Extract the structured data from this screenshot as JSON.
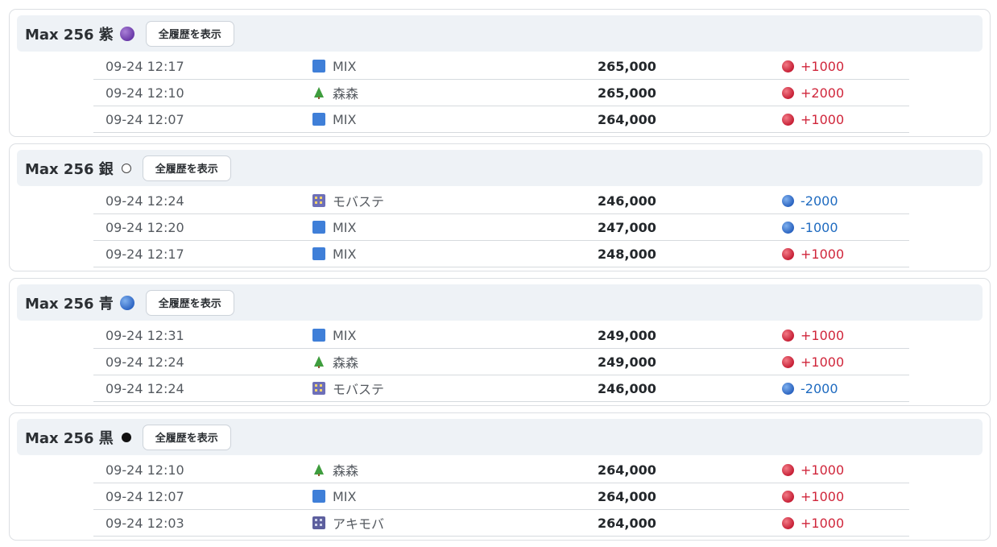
{
  "show_all_label": "全履歴を表示",
  "sections": [
    {
      "title": "Max 256 紫",
      "color_icon": "purple-circle",
      "rows": [
        {
          "time": "09-24 12:17",
          "source_icon": "blue-square",
          "source": "MIX",
          "price": "265,000",
          "direction": "up",
          "change": "+1000"
        },
        {
          "time": "09-24 12:10",
          "source_icon": "tree",
          "source": "森森",
          "price": "265,000",
          "direction": "up",
          "change": "+2000"
        },
        {
          "time": "09-24 12:07",
          "source_icon": "blue-square",
          "source": "MIX",
          "price": "264,000",
          "direction": "up",
          "change": "+1000"
        }
      ]
    },
    {
      "title": "Max 256 銀",
      "color_icon": "white-circle",
      "rows": [
        {
          "time": "09-24 12:24",
          "source_icon": "building",
          "source": "モバステ",
          "price": "246,000",
          "direction": "down",
          "change": "-2000"
        },
        {
          "time": "09-24 12:20",
          "source_icon": "blue-square",
          "source": "MIX",
          "price": "247,000",
          "direction": "down",
          "change": "-1000"
        },
        {
          "time": "09-24 12:17",
          "source_icon": "blue-square",
          "source": "MIX",
          "price": "248,000",
          "direction": "up",
          "change": "+1000"
        }
      ]
    },
    {
      "title": "Max 256 青",
      "color_icon": "blue-circle",
      "rows": [
        {
          "time": "09-24 12:31",
          "source_icon": "blue-square",
          "source": "MIX",
          "price": "249,000",
          "direction": "up",
          "change": "+1000"
        },
        {
          "time": "09-24 12:24",
          "source_icon": "tree",
          "source": "森森",
          "price": "249,000",
          "direction": "up",
          "change": "+1000"
        },
        {
          "time": "09-24 12:24",
          "source_icon": "building",
          "source": "モバステ",
          "price": "246,000",
          "direction": "down",
          "change": "-2000"
        }
      ]
    },
    {
      "title": "Max 256 黒",
      "color_icon": "black-circle",
      "rows": [
        {
          "time": "09-24 12:10",
          "source_icon": "tree",
          "source": "森森",
          "price": "264,000",
          "direction": "up",
          "change": "+1000"
        },
        {
          "time": "09-24 12:07",
          "source_icon": "blue-square",
          "source": "MIX",
          "price": "264,000",
          "direction": "up",
          "change": "+1000"
        },
        {
          "time": "09-24 12:03",
          "source_icon": "station",
          "source": "アキモバ",
          "price": "264,000",
          "direction": "up",
          "change": "+1000"
        }
      ]
    }
  ],
  "colors": {
    "up": "#d0263b",
    "down": "#1f6bc0",
    "header_bg": "#eef2f6"
  }
}
